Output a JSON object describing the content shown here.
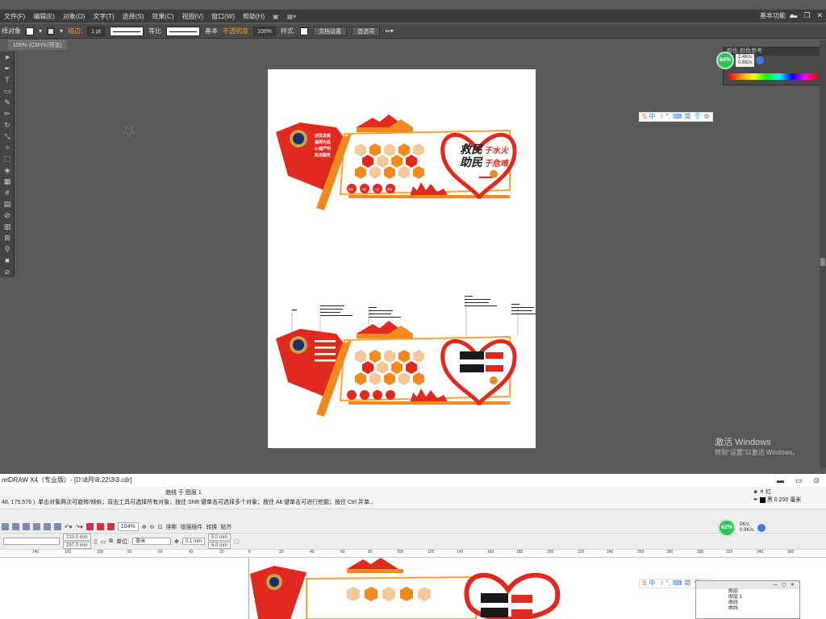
{
  "illustrator": {
    "menu": [
      "文件(F)",
      "编辑(E)",
      "对象(O)",
      "文字(T)",
      "选择(S)",
      "效果(C)",
      "视图(V)",
      "窗口(W)",
      "帮助(H)"
    ],
    "workspace": "基本功能",
    "control_bar": {
      "selection_label": "择对象",
      "stroke_label": "描边:",
      "stroke_value": "1 pt",
      "uniform_label": "等比",
      "basic_label": "基本",
      "opacity_label": "不透明度",
      "opacity_value": "100%",
      "style_label": "样式:",
      "doc_setup_button": "文档设置",
      "prefs_button": "首选项"
    },
    "doc_tab": "100% (CMYK/预览)",
    "panel_tabs": "颜色   颜色参考"
  },
  "network_widget_top": {
    "percent": "64%",
    "up": "2.4K/s",
    "down": "0.6K/s"
  },
  "network_widget_bottom": {
    "percent": "62%",
    "up": "0K/s",
    "down": "0.9K/s"
  },
  "windows_activation": {
    "title": "激活 Windows",
    "subtitle": "转到\"设置\"以激活 Windows。"
  },
  "board_design": {
    "main_text_1": "救民",
    "main_text_2": "助民",
    "accent_text_1": "于水火",
    "accent_text_2": "于危难",
    "badge_lines": [
      "创优发展",
      "漏洞为民",
      "心诚严明",
      "执法服务"
    ],
    "pill_labels": [
      "忠诚",
      "为民",
      "公正",
      "廉洁"
    ]
  },
  "coreldraw": {
    "title": "relDRAW X4（专业版）- [D:\\8月\\8.22\\3\\3.cdr]",
    "object_info": "曲线 于 图层 1",
    "coords": "48, 175.576 )",
    "hint": "单击对象两次可旋转/倾斜；双击工具可选择所有对象；按住 Shift 键单击可选择多个对象；按住 Alt 键单击可进行挖掘；按住 Ctrl 并单...",
    "fill_label": "红",
    "outline_label": "黑  0.200 毫米",
    "zoom": "104%",
    "toolbar_labels": [
      "排斯",
      "增强插件",
      "转换",
      "贴齐"
    ],
    "width": "210.0 mm",
    "height": "297.0 mm",
    "unit_label": "单位:",
    "unit_value": "毫米",
    "nudge": "0.1 mm",
    "dup_x": "5.0 mm",
    "dup_y": "5.0 mm",
    "ruler_ticks": [
      "140",
      "120",
      "100",
      "80",
      "60",
      "40",
      "20",
      "0",
      "20",
      "40",
      "60",
      "80",
      "100",
      "120",
      "140",
      "160",
      "180",
      "200",
      "220",
      "240",
      "260",
      "280",
      "300",
      "320",
      "340",
      "360"
    ],
    "object_manager": {
      "layer_label": "图层:",
      "layer_value": "图层 1",
      "items": [
        "曲线",
        "曲线"
      ]
    }
  },
  "float_toolbar": [
    "中",
    "简"
  ]
}
